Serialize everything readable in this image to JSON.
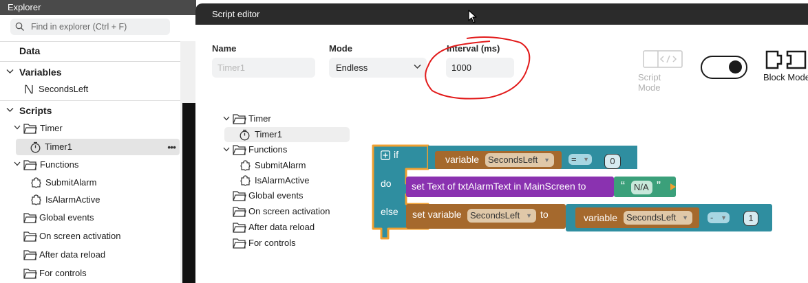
{
  "explorer": {
    "title": "Explorer",
    "search_placeholder": "Find in explorer (Ctrl + F)",
    "data_header": "Data",
    "variables_header": "Variables",
    "variables": [
      "SecondsLeft"
    ],
    "scripts_header": "Scripts",
    "timer_group": "Timer",
    "timer_item": "Timer1",
    "item_menu": "•••",
    "functions_group": "Functions",
    "functions": [
      "SubmitAlarm",
      "IsAlarmActive"
    ],
    "events": [
      "Global events",
      "On screen activation",
      "After data reload",
      "For controls"
    ]
  },
  "editor": {
    "title": "Script editor",
    "name_label": "Name",
    "name_value": "Timer1",
    "mode_label": "Mode",
    "mode_value": "Endless",
    "interval_label": "Interval (ms)",
    "interval_value": "1000",
    "script_mode_label": "Script Mode",
    "block_mode_label": "Block Mode",
    "toggle_on": true,
    "tree": {
      "timer_group": "Timer",
      "timer_item": "Timer1",
      "functions_group": "Functions",
      "functions": [
        "SubmitAlarm",
        "IsAlarmActive"
      ],
      "events": [
        "Global events",
        "On screen activation",
        "After data reload",
        "For controls"
      ]
    }
  },
  "blocks": {
    "if_kw": "if",
    "do_kw": "do",
    "else_kw": "else",
    "variable_kw": "variable",
    "var_name": "SecondsLeft",
    "compare_op": "=",
    "compare_value": "0",
    "set_text": "set Text of txtAlarmText in MainScreen to",
    "open_quote": "“",
    "text_value": "N/A",
    "close_quote": "”",
    "set_variable_kw": "set variable",
    "to_kw": "to",
    "minus_op": "-",
    "minus_value": "1"
  },
  "colors": {
    "control_block": "#2f8ea0",
    "variable_block": "#a5692d",
    "text_block": "#8a32b0",
    "string_block": "#3ba07a",
    "selected_outline": "#f0a030",
    "annotation": "#e21b1b"
  }
}
